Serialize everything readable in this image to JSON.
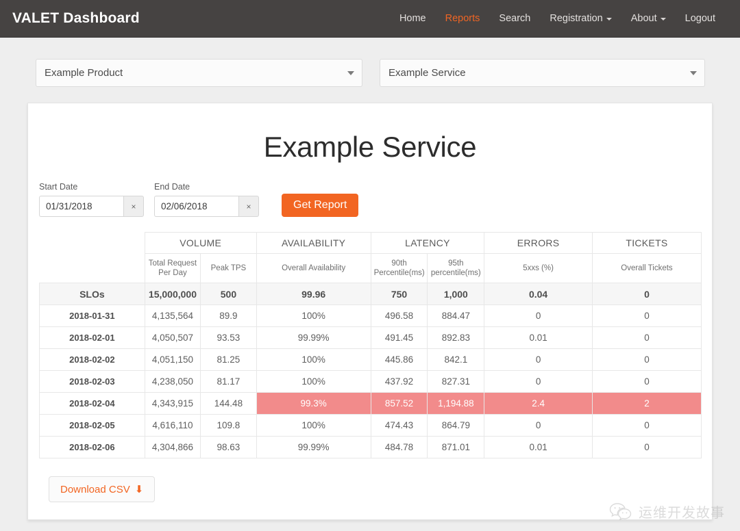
{
  "navbar": {
    "brand": "VALET Dashboard",
    "links": [
      {
        "label": "Home",
        "active": false,
        "caret": false
      },
      {
        "label": "Reports",
        "active": true,
        "caret": false
      },
      {
        "label": "Search",
        "active": false,
        "caret": false
      },
      {
        "label": "Registration",
        "active": false,
        "caret": true
      },
      {
        "label": "About",
        "active": false,
        "caret": true
      },
      {
        "label": "Logout",
        "active": false,
        "caret": false
      }
    ],
    "brand_color": "#ffffff",
    "bg_color": "#464342",
    "active_color": "#ef6524"
  },
  "selectors": {
    "product": {
      "value": "Example Product",
      "icon": "chevron-down-icon"
    },
    "service": {
      "value": "Example Service",
      "icon": "chevron-down-icon"
    }
  },
  "report": {
    "title": "Example Service",
    "start_date": {
      "label": "Start Date",
      "value": "01/31/2018",
      "clear": "×"
    },
    "end_date": {
      "label": "End Date",
      "value": "02/06/2018",
      "clear": "×"
    },
    "get_report_label": "Get Report",
    "download_label": "Download CSV",
    "download_icon": "⬇",
    "accent_color": "#f26522",
    "alert_color": "#f28b8b"
  },
  "table": {
    "group_headers": [
      "",
      "VOLUME",
      "AVAILABILITY",
      "LATENCY",
      "ERRORS",
      "TICKETS"
    ],
    "sub_headers": [
      "",
      "Total Request Per Day",
      "Peak TPS",
      "Overall Availability",
      "90th Percentile(ms)",
      "95th percentile(ms)",
      "5xxs (%)",
      "Overall Tickets"
    ],
    "slos_row": {
      "label": "SLOs",
      "values": [
        "15,000,000",
        "500",
        "99.96",
        "750",
        "1,000",
        "0.04",
        "0"
      ]
    },
    "rows": [
      {
        "label": "2018-01-31",
        "values": [
          "4,135,564",
          "89.9",
          "100%",
          "496.58",
          "884.47",
          "0",
          "0"
        ],
        "alert": false
      },
      {
        "label": "2018-02-01",
        "values": [
          "4,050,507",
          "93.53",
          "99.99%",
          "491.45",
          "892.83",
          "0.01",
          "0"
        ],
        "alert": false
      },
      {
        "label": "2018-02-02",
        "values": [
          "4,051,150",
          "81.25",
          "100%",
          "445.86",
          "842.1",
          "0",
          "0"
        ],
        "alert": false
      },
      {
        "label": "2018-02-03",
        "values": [
          "4,238,050",
          "81.17",
          "100%",
          "437.92",
          "827.31",
          "0",
          "0"
        ],
        "alert": false
      },
      {
        "label": "2018-02-04",
        "values": [
          "4,343,915",
          "144.48",
          "99.3%",
          "857.52",
          "1,194.88",
          "2.4",
          "2"
        ],
        "alert": true,
        "alert_from": 2
      },
      {
        "label": "2018-02-05",
        "values": [
          "4,616,110",
          "109.8",
          "100%",
          "474.43",
          "864.79",
          "0",
          "0"
        ],
        "alert": false
      },
      {
        "label": "2018-02-06",
        "values": [
          "4,304,866",
          "98.63",
          "99.99%",
          "484.78",
          "871.01",
          "0.01",
          "0"
        ],
        "alert": false
      }
    ]
  },
  "watermark": {
    "text": "运维开发故事",
    "icon": "wechat-icon"
  }
}
